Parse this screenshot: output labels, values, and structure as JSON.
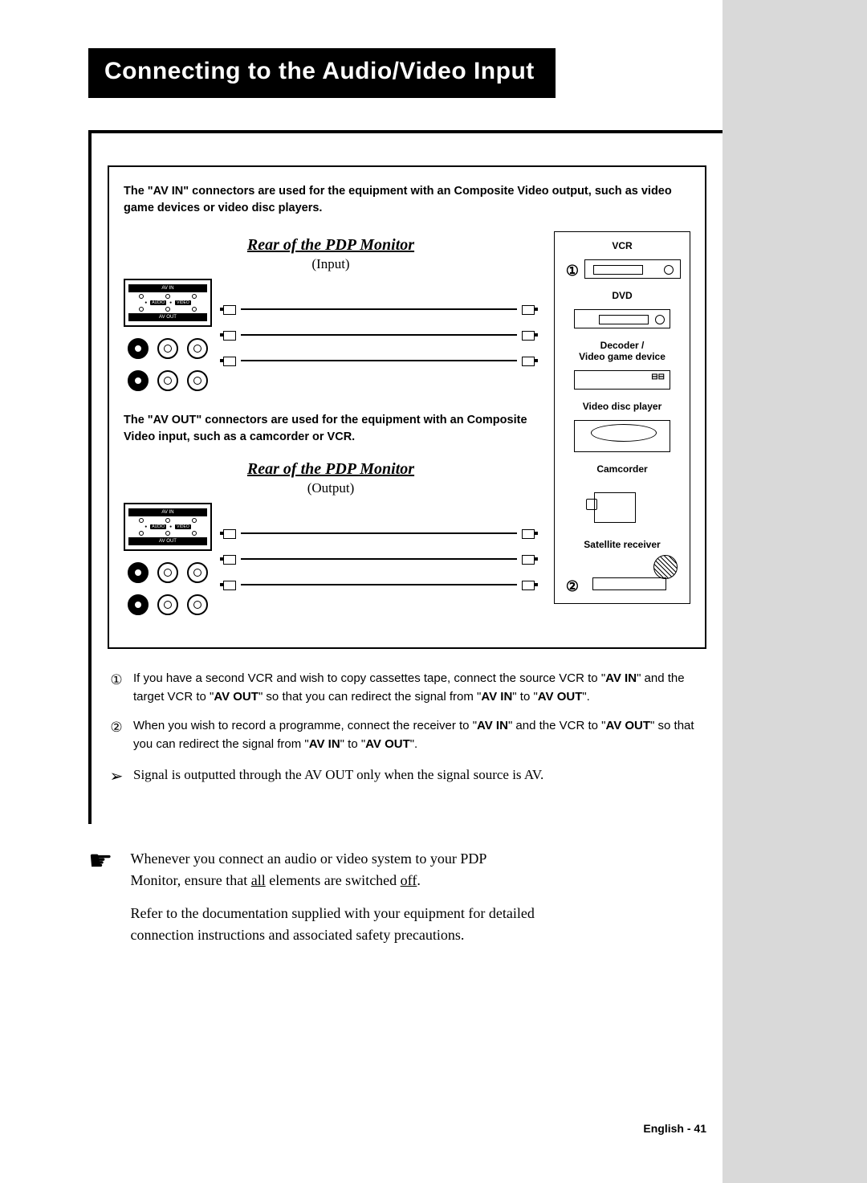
{
  "title": "Connecting to the Audio/Video Input",
  "intro_av_in": "The \"AV IN\" connectors are used for the equipment with an Composite Video output, such as video game devices or video disc players.",
  "rear_title": "Rear of the PDP Monitor",
  "input_label": "(Input)",
  "output_label": "(Output)",
  "panel": {
    "av_in": "AV IN",
    "audio_l": "AUDIO",
    "video": "VIDEO",
    "av_out": "AV OUT"
  },
  "devices": {
    "vcr": "VCR",
    "dvd": "DVD",
    "decoder": "Decoder /",
    "game": "Video game device",
    "disc": "Video disc player",
    "cam": "Camcorder",
    "sat": "Satellite receiver"
  },
  "circled1": "①",
  "circled2": "②",
  "intro_av_out": "The \"AV OUT\" connectors are used for the equipment with an Composite Video input, such as a camcorder or VCR.",
  "note1_a": "If you have a second VCR and wish to copy cassettes tape, connect the source VCR to \"",
  "note1_b": "\" and the target VCR to \"",
  "note1_c": "\" so that you can redirect the signal from \"",
  "note1_d": "\" to \"",
  "note1_e": "\".",
  "av_in_bold": "AV IN",
  "av_out_bold": "AV OUT",
  "note2_a": "When you wish to record a programme, connect the receiver to \"",
  "note2_b": "\" and the VCR to \"",
  "note2_c": "\" so that you can redirect the signal from \"",
  "note2_d": "\" to \"",
  "note2_e": "\".",
  "note3": "Signal is outputted through the AV OUT only when the signal source is AV.",
  "footer1_a": "Whenever you connect an audio or video system to your PDP Monitor, ensure that ",
  "footer1_all": "all",
  "footer1_b": " elements are switched ",
  "footer1_off": "off",
  "footer1_c": ".",
  "footer2": "Refer to the documentation supplied with your equipment for detailed connection instructions and associated safety precautions.",
  "page_num": "English - 41",
  "arrow": "➢",
  "hand": "☛"
}
